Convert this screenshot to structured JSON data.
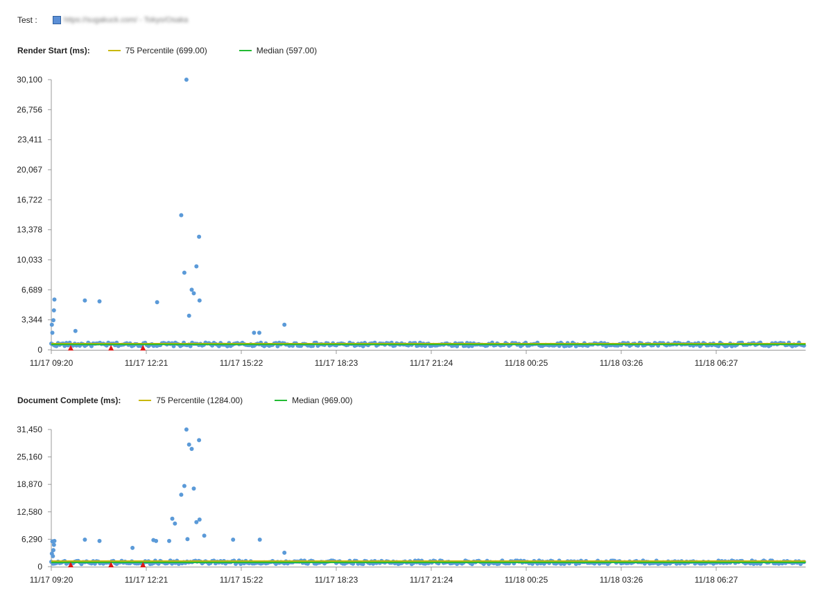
{
  "test": {
    "label": "Test :",
    "value": "https://sugakuck.com/ - Tokyo/Osaka",
    "swatch_color": "#5b8fd6"
  },
  "colors": {
    "points": "#5b9ad8",
    "p75": "#c9b800",
    "median": "#22bb33",
    "error": "#e01818",
    "axis": "#999999"
  },
  "charts": [
    {
      "title": "Render Start (ms):",
      "legend": [
        {
          "label": "75 Percentile (699.00)",
          "color": "#c9b800"
        },
        {
          "label": "Median (597.00)",
          "color": "#22bb33"
        }
      ]
    },
    {
      "title": "Document Complete (ms):",
      "legend": [
        {
          "label": "75 Percentile (1284.00)",
          "color": "#c9b800"
        },
        {
          "label": "Median (969.00)",
          "color": "#22bb33"
        }
      ]
    }
  ],
  "chart_data": [
    {
      "type": "scatter",
      "title": "Render Start (ms):",
      "xlabel": "",
      "ylabel": "",
      "x_tick_labels": [
        "11/17 09:20",
        "11/17 12:21",
        "11/17 15:22",
        "11/17 18:23",
        "11/17 21:24",
        "11/18 00:25",
        "11/18 03:26",
        "11/18 06:27"
      ],
      "y_ticks": [
        "30,100",
        "26,756",
        "23,411",
        "20,067",
        "16,722",
        "13,378",
        "10,033",
        "6,689",
        "3,344",
        "0"
      ],
      "ylim": [
        0,
        30100
      ],
      "x_range_minutes": [
        0,
        1440
      ],
      "reference_lines": [
        {
          "name": "75 Percentile",
          "value": 699
        },
        {
          "name": "Median",
          "value": 597
        }
      ],
      "baseline": {
        "typical": 600,
        "spread": 200
      },
      "outliers": [
        {
          "x": 1,
          "y": 2800
        },
        {
          "x": 2,
          "y": 1900
        },
        {
          "x": 4,
          "y": 3300
        },
        {
          "x": 5,
          "y": 4400
        },
        {
          "x": 6,
          "y": 5600
        },
        {
          "x": 46,
          "y": 2100
        },
        {
          "x": 64,
          "y": 5500
        },
        {
          "x": 92,
          "y": 5400
        },
        {
          "x": 202,
          "y": 5300
        },
        {
          "x": 248,
          "y": 15000
        },
        {
          "x": 254,
          "y": 8600
        },
        {
          "x": 258,
          "y": 30100
        },
        {
          "x": 263,
          "y": 3800
        },
        {
          "x": 268,
          "y": 6700
        },
        {
          "x": 272,
          "y": 6300
        },
        {
          "x": 277,
          "y": 9300
        },
        {
          "x": 282,
          "y": 12600
        },
        {
          "x": 283,
          "y": 5500
        },
        {
          "x": 387,
          "y": 1900
        },
        {
          "x": 397,
          "y": 1900
        },
        {
          "x": 445,
          "y": 2800
        }
      ],
      "errors": [
        {
          "x": 37,
          "y": 0
        },
        {
          "x": 114,
          "y": 0
        },
        {
          "x": 175,
          "y": 0
        }
      ]
    },
    {
      "type": "scatter",
      "title": "Document Complete (ms):",
      "xlabel": "",
      "ylabel": "",
      "x_tick_labels": [
        "11/17 09:20",
        "11/17 12:21",
        "11/17 15:22",
        "11/17 18:23",
        "11/17 21:24",
        "11/18 00:25",
        "11/18 03:26",
        "11/18 06:27"
      ],
      "y_ticks": [
        "31,450",
        "25,160",
        "18,870",
        "12,580",
        "6,290",
        "0"
      ],
      "ylim": [
        0,
        31450
      ],
      "x_range_minutes": [
        0,
        1440
      ],
      "reference_lines": [
        {
          "name": "75 Percentile",
          "value": 1284
        },
        {
          "name": "Median",
          "value": 969
        }
      ],
      "baseline": {
        "typical": 1000,
        "spread": 400
      },
      "outliers": [
        {
          "x": 1,
          "y": 3000
        },
        {
          "x": 2,
          "y": 5800
        },
        {
          "x": 3,
          "y": 2400
        },
        {
          "x": 4,
          "y": 3800
        },
        {
          "x": 5,
          "y": 5000
        },
        {
          "x": 6,
          "y": 5900
        },
        {
          "x": 64,
          "y": 6200
        },
        {
          "x": 92,
          "y": 5900
        },
        {
          "x": 155,
          "y": 4300
        },
        {
          "x": 195,
          "y": 6100
        },
        {
          "x": 200,
          "y": 5900
        },
        {
          "x": 225,
          "y": 5900
        },
        {
          "x": 231,
          "y": 11000
        },
        {
          "x": 236,
          "y": 9900
        },
        {
          "x": 248,
          "y": 16500
        },
        {
          "x": 254,
          "y": 18500
        },
        {
          "x": 258,
          "y": 31450
        },
        {
          "x": 260,
          "y": 6300
        },
        {
          "x": 263,
          "y": 28000
        },
        {
          "x": 268,
          "y": 27000
        },
        {
          "x": 272,
          "y": 17900
        },
        {
          "x": 277,
          "y": 10200
        },
        {
          "x": 282,
          "y": 29000
        },
        {
          "x": 283,
          "y": 10800
        },
        {
          "x": 292,
          "y": 7100
        },
        {
          "x": 347,
          "y": 6200
        },
        {
          "x": 398,
          "y": 6200
        },
        {
          "x": 445,
          "y": 3200
        }
      ],
      "errors": [
        {
          "x": 37,
          "y": 0
        },
        {
          "x": 114,
          "y": 0
        },
        {
          "x": 175,
          "y": 0
        }
      ]
    }
  ]
}
